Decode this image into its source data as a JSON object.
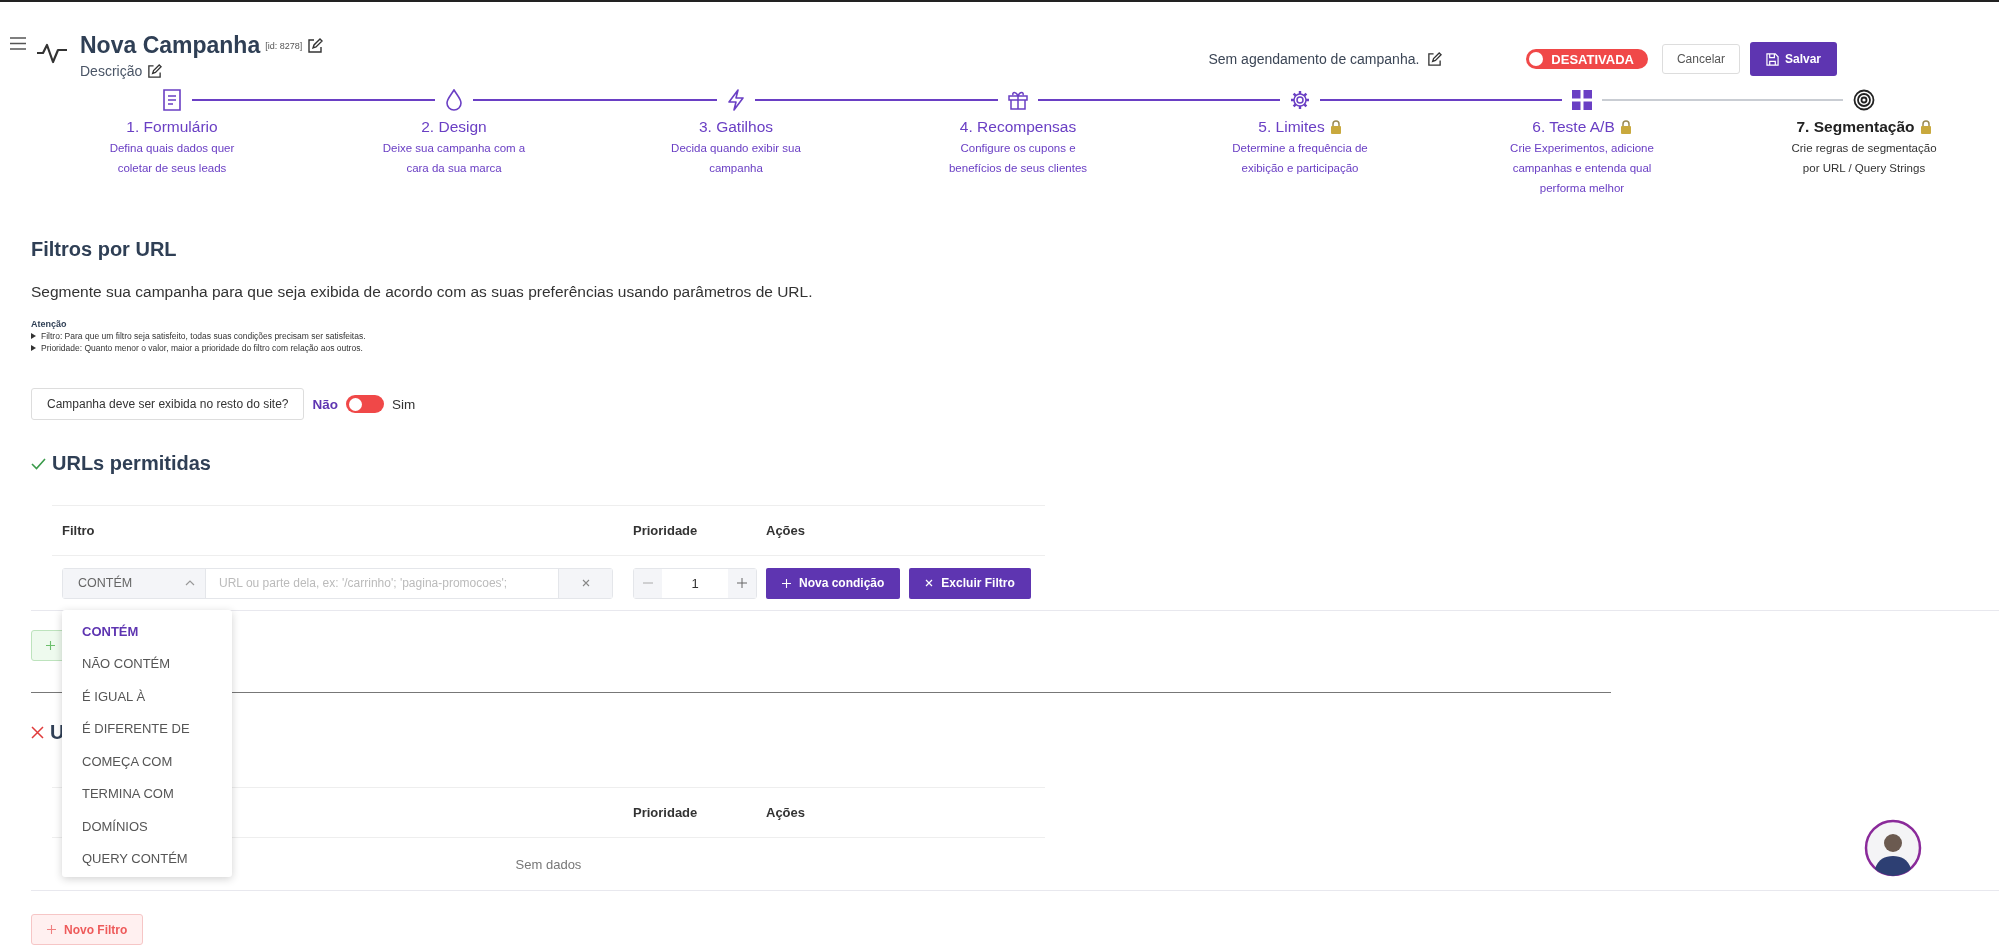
{
  "header": {
    "title": "Nova Campanha",
    "id_label": "[id: 8278]",
    "description": "Descrição",
    "schedule": "Sem agendamento de campanha.",
    "status": {
      "label": "DESATIVADA",
      "on": false
    },
    "buttons": [
      {
        "label": "Cancelar",
        "kind": "secondary"
      },
      {
        "label": "Salvar",
        "kind": "primary"
      }
    ]
  },
  "steps": [
    {
      "title": "1. Formulário",
      "description": "Defina quais dados quer coletar de seus leads",
      "locked": false,
      "selected": false
    },
    {
      "title": "2. Design",
      "description": "Deixe sua campanha com a cara da sua marca",
      "locked": false,
      "selected": false
    },
    {
      "title": "3. Gatilhos",
      "description": "Decida quando exibir sua campanha",
      "locked": false,
      "selected": false
    },
    {
      "title": "4. Recompensas",
      "description": "Configure os cupons e benefícios de seus clientes",
      "locked": false,
      "selected": false
    },
    {
      "title": "5. Limites",
      "description": "Determine a frequência de exibição e participação",
      "locked": true,
      "selected": false
    },
    {
      "title": "6. Teste A/B",
      "description": "Crie Experimentos, adicione campanhas e entenda qual performa melhor",
      "locked": true,
      "selected": false
    },
    {
      "title": "7. Segmentação",
      "description": "Crie regras de segmentação por URL / Query Strings",
      "locked": true,
      "selected": true
    }
  ],
  "section": {
    "title": "Filtros por URL",
    "description": "Segmente sua campanha para que seja exibida de acordo com as suas preferências usando parâmetros de URL.",
    "notice": {
      "title": "Atenção",
      "items": [
        "Filtro: Para que um filtro seja satisfeito, todas suas condições precisam ser satisfeitas.",
        "Prioridade: Quanto menor o valor, maior a prioridade do filtro com relação aos outros."
      ]
    },
    "rest_of_site": {
      "question": "Campanha deve ser exibida no resto do site?",
      "off_label": "Não",
      "on_label": "Sim",
      "on": false
    }
  },
  "allowed": {
    "title": "URLs permitidas",
    "columns": [
      "Filtro",
      "Prioridade",
      "Ações"
    ],
    "rows": [
      {
        "operator": "CONTÉM",
        "placeholder": "URL ou parte dela, ex: '/carrinho'; 'pagina-promocoes';",
        "priority": "1",
        "buttons": [
          "Nova condição",
          "Excluir Filtro"
        ]
      }
    ]
  },
  "operator_menu": {
    "expanded": true,
    "options": [
      {
        "label": "CONTÉM",
        "selected": true
      },
      {
        "label": "NÃO CONTÉM",
        "selected": false
      },
      {
        "label": "É IGUAL À",
        "selected": false
      },
      {
        "label": "É DIFERENTE DE",
        "selected": false
      },
      {
        "label": "COMEÇA COM",
        "selected": false
      },
      {
        "label": "TERMINA COM",
        "selected": false
      },
      {
        "label": "DOMÍNIOS",
        "selected": false
      },
      {
        "label": "QUERY CONTÉM",
        "selected": false
      }
    ]
  },
  "blocked": {
    "title": "U",
    "columns": [
      "Prioridade",
      "Ações"
    ],
    "empty": "Sem dados",
    "add_button": "Novo Filtro"
  }
}
